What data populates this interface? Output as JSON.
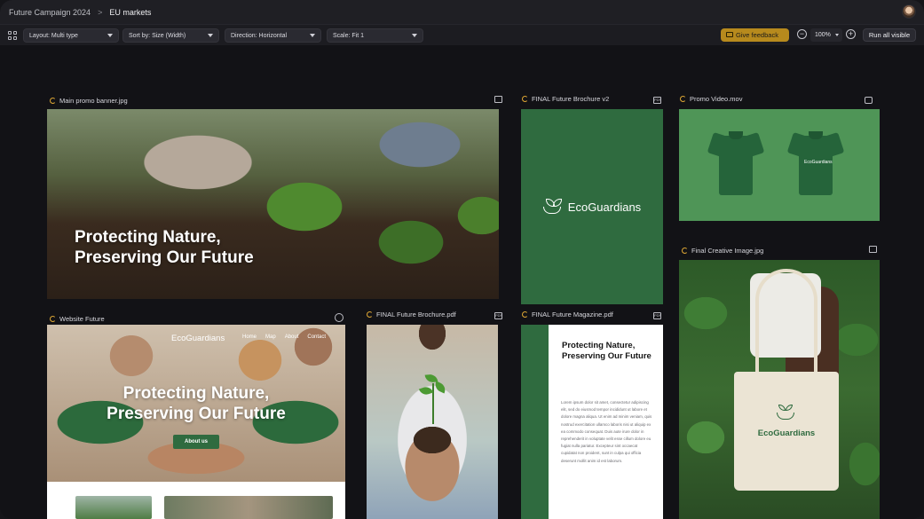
{
  "breadcrumb": {
    "project": "Future Campaign 2024",
    "separator": ">",
    "current": "EU markets"
  },
  "toolbar": {
    "layout": "Layout: Multi type",
    "sort": "Sort by: Size (Width)",
    "direction": "Direction: Horizontal",
    "scale": "Scale: Fit 1",
    "feedback": "Give feedback",
    "zoom": "100%",
    "zoom_out": "−",
    "zoom_in": "+",
    "run_all": "Run all visible"
  },
  "assets": {
    "banner": {
      "name": "Main promo banner.jpg",
      "headline_1": "Protecting Nature,",
      "headline_2": "Preserving Our Future",
      "type_icon": "image-icon"
    },
    "brochure_v2": {
      "name": "FINAL Future Brochure v2",
      "brand": "EcoGuardians",
      "type_icon": "pdf-icon",
      "type_label": "PDF"
    },
    "video": {
      "name": "Promo Video.mov",
      "shirt_logo": "EcoGuardians",
      "type_icon": "video-camera-icon"
    },
    "creative": {
      "name": "Final Creative Image.jpg",
      "brand": "EcoGuardians",
      "type_icon": "image-icon"
    },
    "website": {
      "name": "Website Future",
      "brand": "EcoGuardians",
      "nav": [
        "Home",
        "Map",
        "About",
        "Contact"
      ],
      "headline_1": "Protecting Nature,",
      "headline_2": "Preserving Our Future",
      "cta": "About us",
      "type_icon": "globe-icon"
    },
    "brochure_pdf": {
      "name": "FINAL Future Brochure.pdf",
      "type_icon": "pdf-icon",
      "type_label": "PDF"
    },
    "magazine": {
      "name": "FINAL Future Magazine.pdf",
      "title": "Protecting Nature, Preserving Our Future",
      "body": "Lorem ipsum dolor sit amet, consectetur adipiscing elit, sed do eiusmod tempor incididunt ut labore et dolore magna aliqua. Ut enim ad minim veniam, quis nostrud exercitation ullamco laboris nisi ut aliquip ex ea commodo consequat. Duis aute irure dolor in reprehenderit in voluptate velit esse cillum dolore eu fugiat nulla pariatur. Excepteur sint occaecat cupidatat non proident, sunt in culpa qui officia deserunt mollit anim id est laborum.",
      "type_icon": "pdf-icon",
      "type_label": "PDF"
    }
  },
  "colors": {
    "brand_green": "#2f6b3f",
    "feedback_yellow": "#b78a1d",
    "status_ring": "#e0a834"
  }
}
